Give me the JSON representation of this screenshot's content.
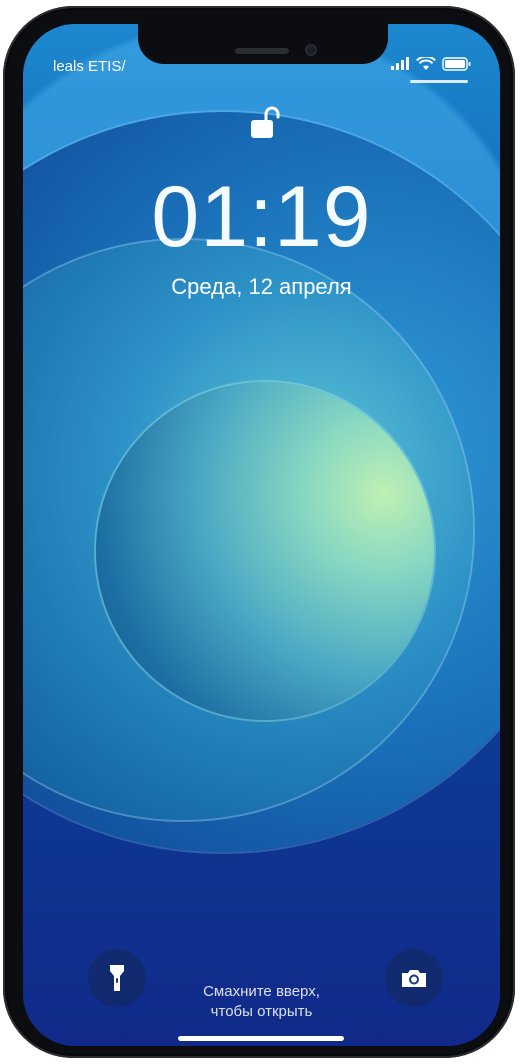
{
  "status_bar": {
    "carrier": "leals ETIS/",
    "signal_icon": "signal-icon",
    "wifi_icon": "wifi-icon",
    "battery_icon": "battery-icon"
  },
  "lock_screen": {
    "lock_icon": "unlock-icon",
    "time": "01:19",
    "date": "Среда, 12 апреля",
    "swipe_hint_line1": "Смахните вверх,",
    "swipe_hint_line2": "чтобы открыть"
  },
  "controls": {
    "flashlight_icon": "flashlight-icon",
    "camera_icon": "camera-icon"
  },
  "colors": {
    "text": "#ffffff",
    "wallpaper_primary": "#1168b6",
    "wallpaper_accent": "#bff0b4"
  }
}
